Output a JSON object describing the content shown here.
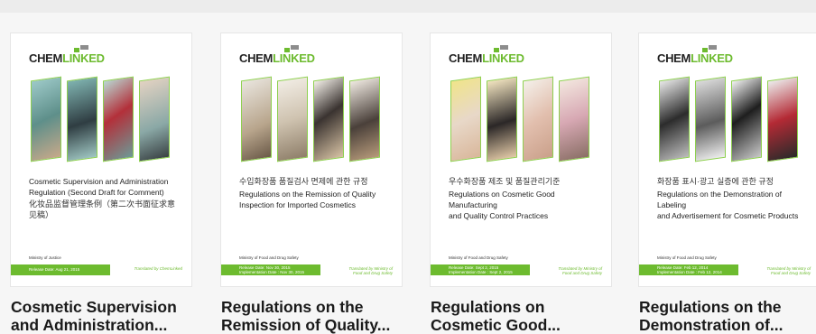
{
  "brand": {
    "chem": "CHEM",
    "linked": "LINKED",
    "green": "#6dbb2f"
  },
  "cards": [
    {
      "cover_title_lines": [
        "Cosmetic Supervision and Administration",
        "Regulation (Second Draft for Comment)"
      ],
      "cover_subtitle": "化妆品监督管理条例（第二次书面征求意见稿）",
      "ministry": "Ministry of Justice",
      "dates": [
        "Release Date: Aug 21, 2015"
      ],
      "translated": "Translated by ChemLinked",
      "caption_lines": [
        "Cosmetic Supervision",
        "and Administration..."
      ]
    },
    {
      "cover_korean": "수입화장품 품질검사 면제에 관한 규정",
      "cover_title_lines": [
        "Regulations on the Remission of Quality",
        "Inspection for Imported Cosmetics"
      ],
      "ministry": "Ministry of Food and Drug Safety",
      "dates": [
        "Release Date: Nov 30, 2015",
        "Implementation Date : Nov 30, 2015"
      ],
      "translated": "Translated by Ministry of Food and Drug Safety",
      "caption_lines": [
        "Regulations on the",
        "Remission of Quality..."
      ]
    },
    {
      "cover_korean": "우수화장품 제조 및 품질관리기준",
      "cover_title_lines": [
        "Regulations on Cosmetic Good Manufacturing",
        "and Quality Control Practices"
      ],
      "ministry": "Ministry of Food and Drug Safety",
      "dates": [
        "Release Date: Sept 2, 2015",
        "Implementation Date : Sept 2, 2015"
      ],
      "translated": "Translated by Ministry of Food and Drug Safety",
      "caption_lines": [
        "Regulations on",
        "Cosmetic Good..."
      ]
    },
    {
      "cover_korean": "화장품 표시·광고 실증에 관한 규정",
      "cover_title_lines": [
        "Regulations on the Demonstration of Labeling",
        "and Advertisement for Cosmetic Products"
      ],
      "ministry": "Ministry of Food and Drug Safety",
      "dates": [
        "Release Date: Feb 12, 2014",
        "Implementation Date : Feb 12, 2014"
      ],
      "translated": "Translated by Ministry of Food and Drug Safety",
      "caption_lines": [
        "Regulations on the",
        "Demonstration of..."
      ]
    }
  ]
}
